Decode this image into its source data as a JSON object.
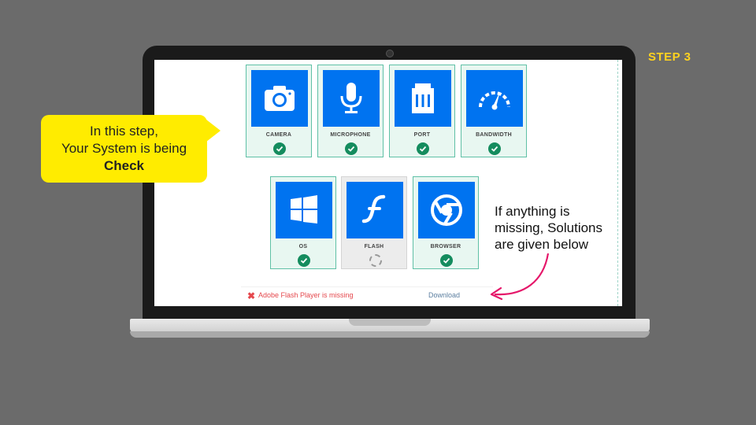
{
  "step_label": "STEP 3",
  "callout": {
    "line1": "In this step,",
    "line2": "Your System is being",
    "line3": "Check"
  },
  "side_note": "If anything is missing, Solutions are given below",
  "checks": [
    {
      "label": "CAMERA",
      "icon": "camera-icon",
      "status": "ok"
    },
    {
      "label": "MICROPHONE",
      "icon": "microphone-icon",
      "status": "ok"
    },
    {
      "label": "PORT",
      "icon": "port-icon",
      "status": "ok"
    },
    {
      "label": "BANDWIDTH",
      "icon": "speedometer-icon",
      "status": "ok"
    },
    {
      "label": "OS",
      "icon": "windows-icon",
      "status": "ok"
    },
    {
      "label": "FLASH",
      "icon": "flash-icon",
      "status": "loading"
    },
    {
      "label": "BROWSER",
      "icon": "chrome-icon",
      "status": "ok"
    }
  ],
  "message": {
    "text": "Adobe Flash Player is missing",
    "link": "Download"
  },
  "colors": {
    "tile": "#0073f0",
    "ok": "#148c5e",
    "error": "#e5484d",
    "callout": "#ffec00",
    "step": "#ffd21f",
    "arrow": "#e5176a"
  }
}
